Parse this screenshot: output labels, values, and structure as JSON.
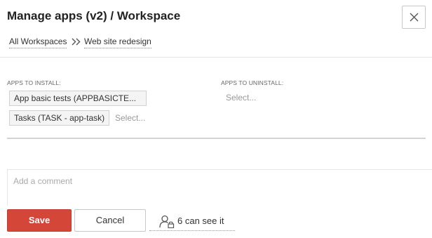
{
  "header": {
    "title": "Manage apps (v2) / Workspace",
    "close_icon": "close-icon"
  },
  "breadcrumb": {
    "items": [
      "All Workspaces",
      "Web site redesign"
    ],
    "separator_icon": "double-chevron-right-icon"
  },
  "install": {
    "label": "APPS TO INSTALL:",
    "chips": [
      "App basic tests (APPBASICTE...",
      "Tasks (TASK - app-task)"
    ],
    "placeholder": "Select..."
  },
  "uninstall": {
    "label": "APPS TO UNINSTALL:",
    "placeholder": "Select..."
  },
  "comment": {
    "placeholder": "Add a comment"
  },
  "footer": {
    "save_label": "Save",
    "cancel_label": "Cancel",
    "visibility_label": "6 can see it",
    "visibility_icon": "user-lock-icon",
    "accent_color": "#d44638"
  }
}
